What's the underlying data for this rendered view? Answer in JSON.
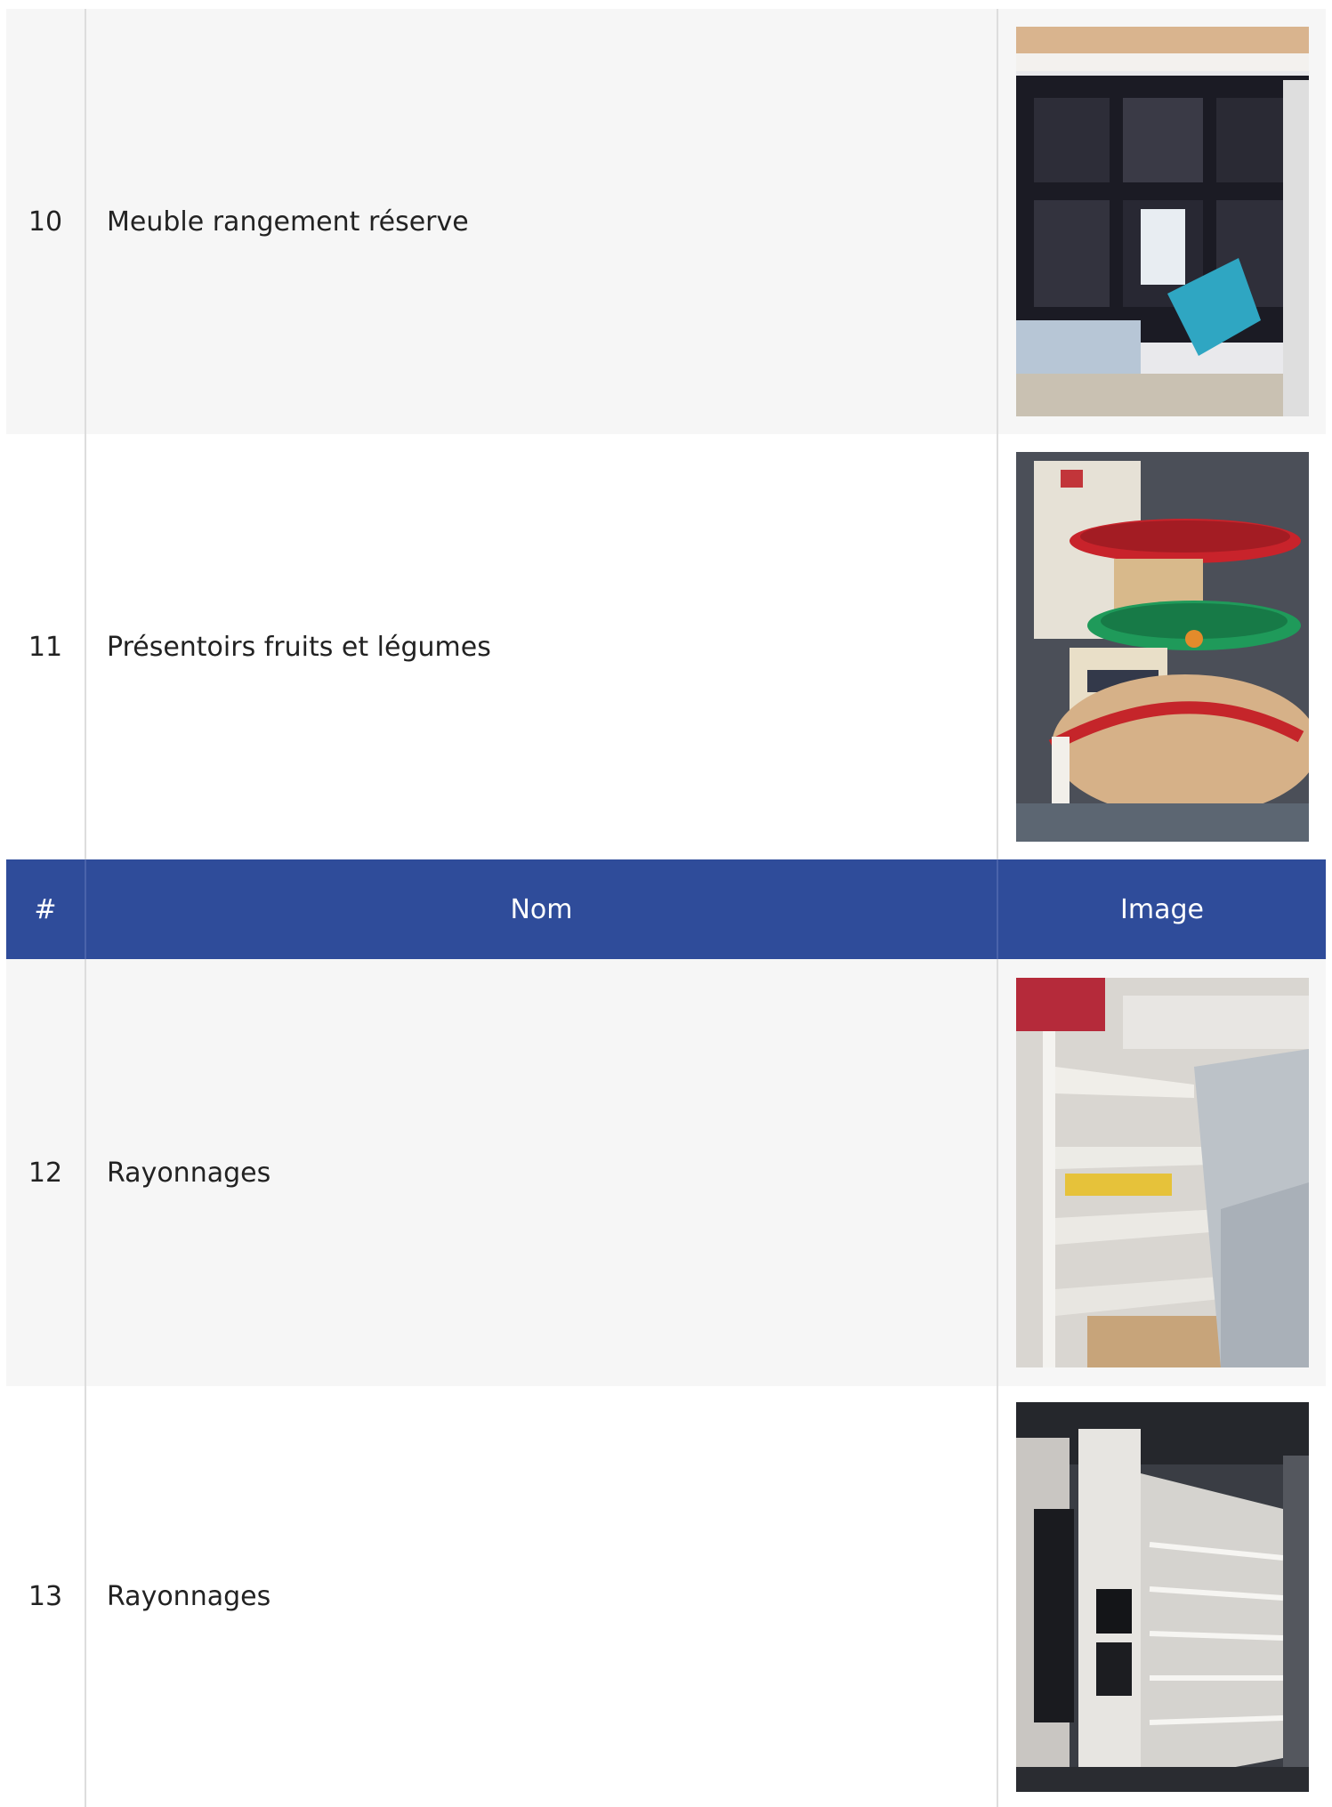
{
  "header": {
    "col_num": "#",
    "col_name": "Nom",
    "col_image": "Image"
  },
  "rows": [
    {
      "num": "10",
      "name": "Meuble rangement réserve",
      "image_icon": "storage-shelf-photo"
    },
    {
      "num": "11",
      "name": "Présentoirs fruits et légumes",
      "image_icon": "produce-display-photo"
    },
    {
      "num": "12",
      "name": "Rayonnages",
      "image_icon": "shelving-photo"
    },
    {
      "num": "13",
      "name": "Rayonnages",
      "image_icon": "shelving-photo"
    }
  ],
  "colors": {
    "header_bg": "#2f4c9a",
    "row_alt_bg": "#f6f6f6"
  }
}
